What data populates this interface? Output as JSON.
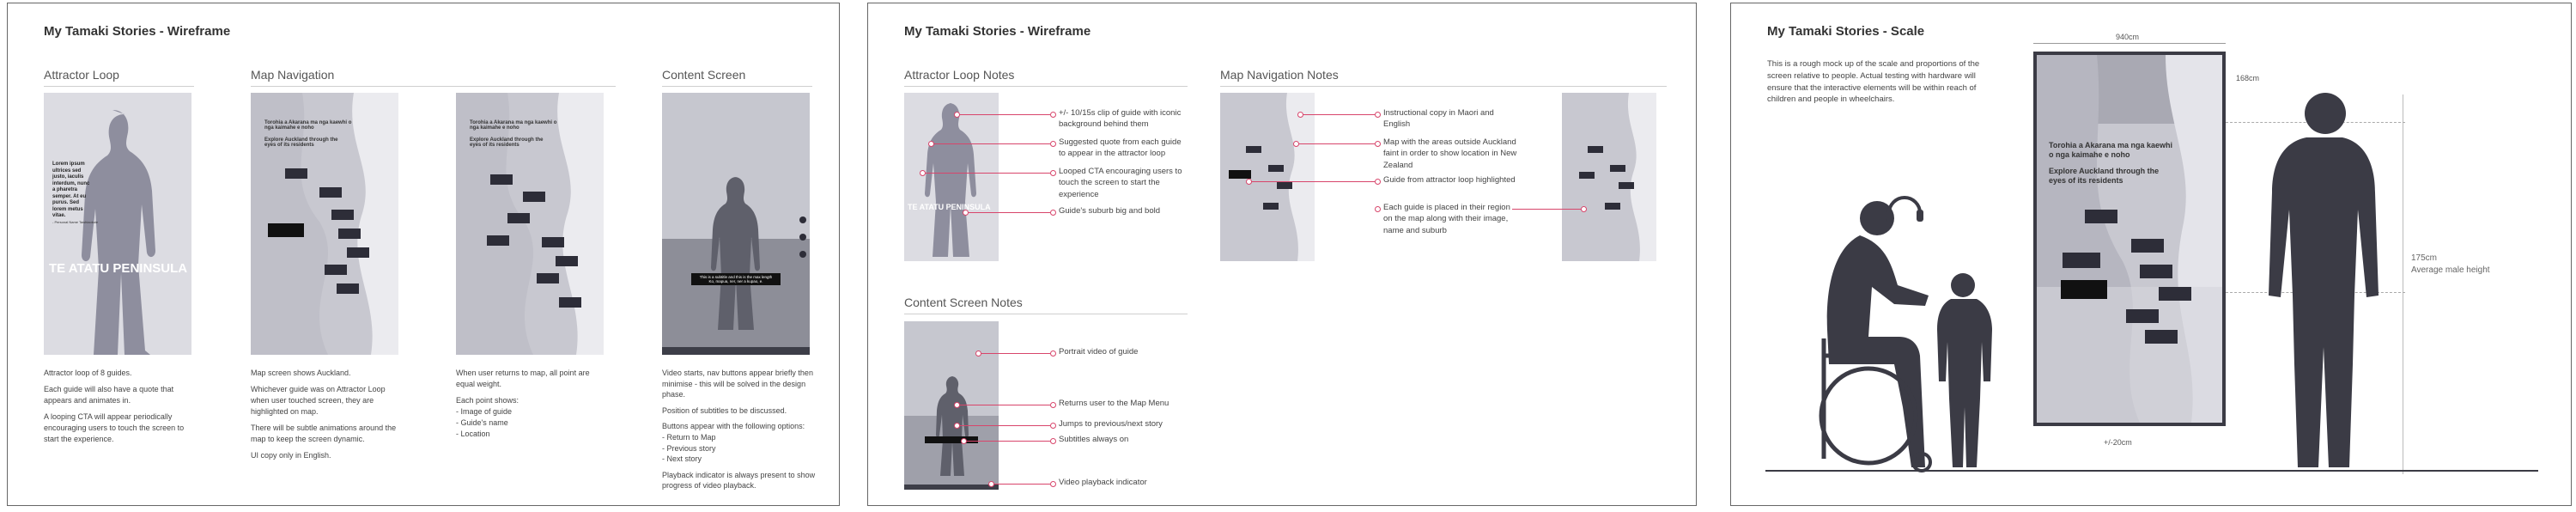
{
  "panel1": {
    "title": "My Tamaki Stories - Wireframe",
    "sections": [
      "Attractor Loop",
      "Map Navigation",
      "Content Screen"
    ],
    "attractor_quote": "Lorem ipsum ultrices sed justo, iaculis interdum, nunc a pharetra semper. At eu purus. Sed lorem metus vitae.",
    "attractor_attrib": "- Personal Name Tawhiaokoie",
    "attractor_suburb": "TE ATATU PENINSULA",
    "map_heading": "Torohia a Akarana ma nga kaewhi o nga kaimahe e noho",
    "map_sub": "Explore Auckland through the eyes of its residents",
    "subtitle_line1": "This is a subtitle and this is the max length",
    "subtitle_line2": "Ko, mapua, ner, ner a kupao, e.",
    "desc_attractor": [
      "Attractor loop of 8 guides.",
      "Each guide will also have a quote that appears and animates in.",
      "A looping CTA will appear periodically encouraging users to touch the screen to start the experience."
    ],
    "desc_map": [
      "Map screen shows Auckland.",
      "Whichever guide was on Attractor Loop when user touched screen, they are highlighted on map.",
      "There will be subtle animations around the map to keep the screen dynamic.",
      "UI copy only in English."
    ],
    "desc_map2": [
      "When user returns to map, all point are equal weight.",
      "Each point shows:\n- Image of guide\n- Guide's name\n- Location"
    ],
    "desc_content": [
      "Video starts, nav buttons appear briefly then minimise - this will be solved in the design phase.",
      "Position of subtitles to be discussed.",
      "Buttons appear with the following options:\n- Return to Map\n- Previous story\n- Next story",
      "Playback indicator is always present to show progress of video playback."
    ]
  },
  "panel2": {
    "title": "My Tamaki Stories - Wireframe",
    "sections": [
      "Attractor Loop Notes",
      "Map Navigation Notes",
      "Content Screen Notes"
    ],
    "attractor_notes": [
      "+/- 10/15s clip of guide with iconic background behind them",
      "Suggested quote from each guide to appear in the attractor loop",
      "Looped CTA encouraging users to touch the screen to start the experience",
      "Guide's suburb big and bold"
    ],
    "map_notes": [
      "Instructional copy in Maori and English",
      "Map with the areas outside Auckland faint in order to show location in New Zealand",
      "Guide from attractor loop highlighted",
      "Each guide is placed in their region on the map along with their image, name and suburb"
    ],
    "content_notes": [
      "Portrait video of guide",
      "Returns user to the Map Menu",
      "Jumps to previous/next story",
      "Subtitles always on",
      "Video playback indicator"
    ],
    "mini_suburb": "TE ATATU PENINSULA"
  },
  "panel3": {
    "title": "My Tamaki Stories - Scale",
    "intro": "This is a rough mock up of the scale and proportions of the screen relative to people. Actual testing with hardware will ensure that the interactive elements will be within reach of children and people in wheelchairs.",
    "width_label": "940cm",
    "top_label": "168cm",
    "height_label": "175cm\nAverage male height",
    "bottom_label": "+/-20cm",
    "screen_heading": "Torohia a Akarana ma nga kaewhi o nga kaimahe e noho",
    "screen_sub": "Explore Auckland through the eyes of its residents"
  },
  "colors": {
    "accent": "#d8456b",
    "silhouette": "#8e8e9e",
    "dark_silhouette": "#3b3b45"
  }
}
